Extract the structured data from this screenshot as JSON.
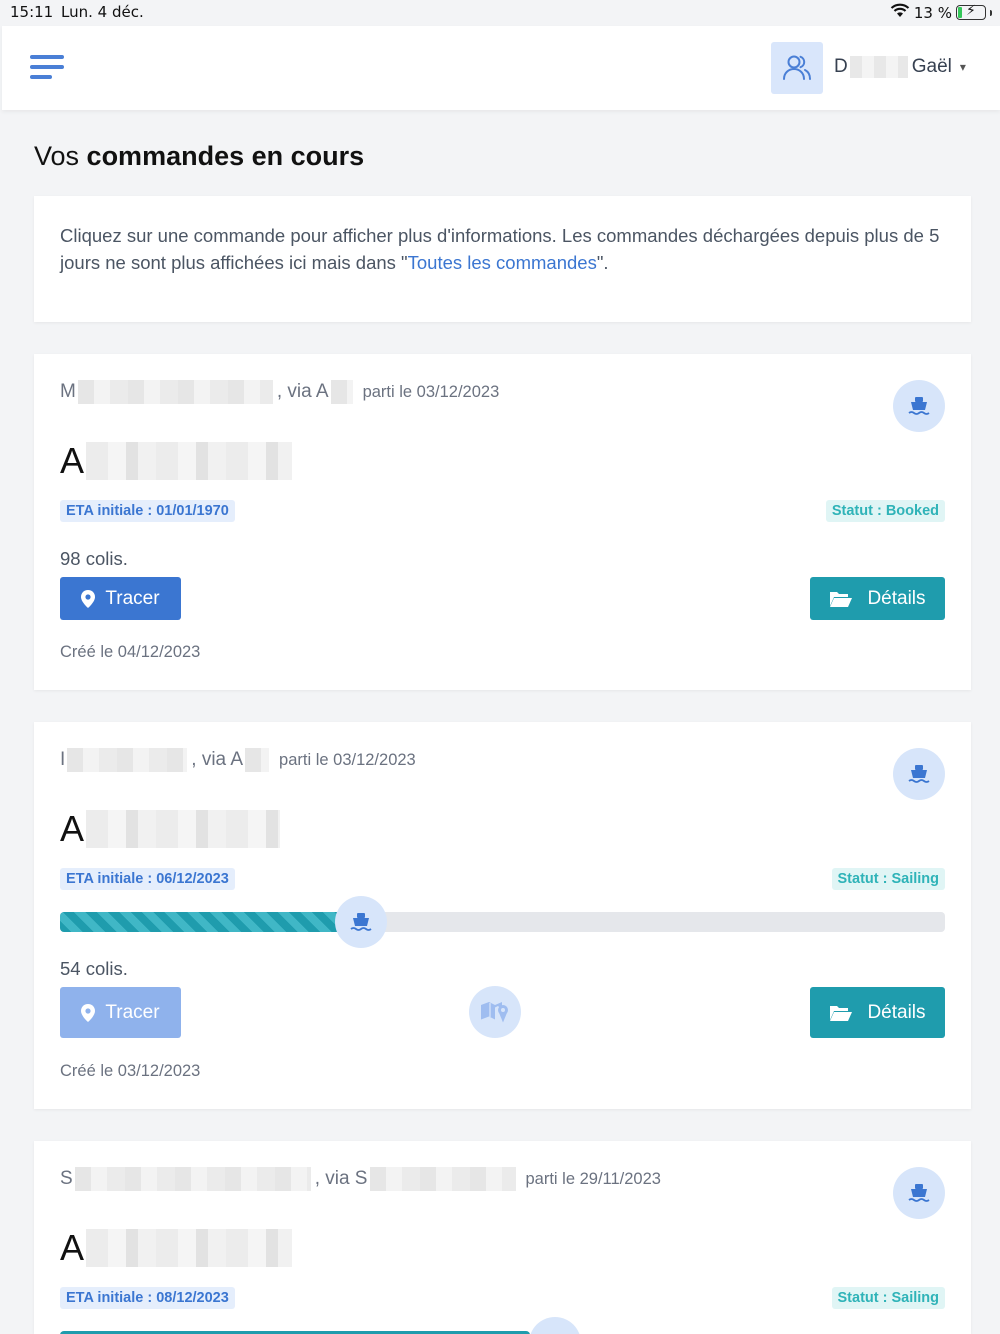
{
  "status_bar": {
    "time": "15:11",
    "date": "Lun. 4 déc.",
    "battery": "13 %"
  },
  "header": {
    "user_initial": "D",
    "user_firstname": "Gaël"
  },
  "page": {
    "title_prefix": "Vos ",
    "title_bold": "commandes en cours",
    "info_text": "Cliquez sur une commande pour afficher plus d'informations. Les commandes déchargées depuis plus de 5 jours ne sont plus affichées ici mais dans \"",
    "info_link": "Toutes les commandes",
    "info_end": "\"."
  },
  "orders": [
    {
      "origin_initial": "M",
      "via_text": ", via A",
      "departed": "parti le 03/12/2023",
      "dest_initial": "A",
      "eta": "ETA initiale : 01/01/1970",
      "status": "Statut : Booked",
      "colis": "98 colis.",
      "tracer_label": "Tracer",
      "details_label": "Détails",
      "created": "Créé le 04/12/2023"
    },
    {
      "origin_initial": "I",
      "via_text": ", via A",
      "departed": "parti le 03/12/2023",
      "dest_initial": "A",
      "eta": "ETA initiale : 06/12/2023",
      "status": "Statut : Sailing",
      "progress": 0.34,
      "colis": "54 colis.",
      "tracer_label": "Tracer",
      "details_label": "Détails",
      "created": "Créé le 03/12/2023"
    },
    {
      "origin_initial": "S",
      "via_text": ", via S",
      "departed": "parti le 29/11/2023",
      "dest_initial": "A",
      "eta": "ETA initiale : 08/12/2023",
      "status": "Statut : Sailing"
    }
  ],
  "colors": {
    "primary": "#3b76d1",
    "teal": "#1f9cad",
    "status_text": "#2fb3b8"
  }
}
